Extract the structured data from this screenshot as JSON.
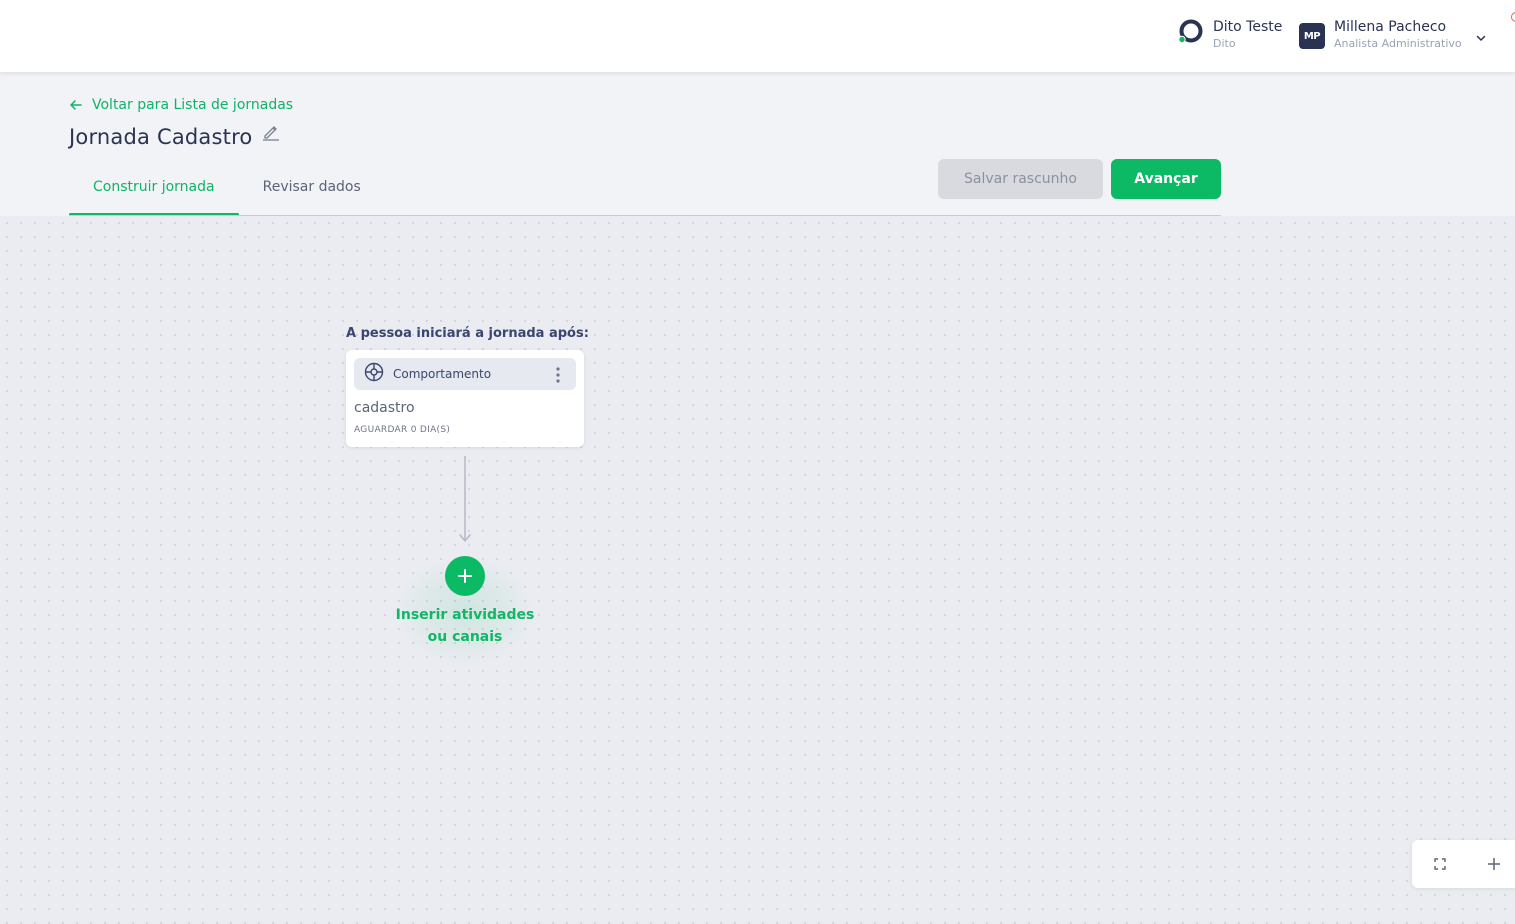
{
  "topbar": {
    "brand": {
      "name": "Dito Teste",
      "subtitle": "Dito"
    },
    "user": {
      "initials": "MP",
      "name": "Millena Pacheco",
      "role": "Analista Administrativo"
    }
  },
  "header": {
    "back_link": "Voltar para Lista de jornadas",
    "title": "Jornada Cadastro",
    "tabs": [
      {
        "label": "Construir jornada",
        "active": true
      },
      {
        "label": "Revisar dados",
        "active": false
      }
    ],
    "buttons": {
      "save_draft": "Salvar rascunho",
      "next": "Avançar"
    }
  },
  "canvas": {
    "start_label": "A pessoa iniciará a jornada após:",
    "trigger_node": {
      "type_label": "Comportamento",
      "type_icon": "behavior-icon",
      "event_name": "cadastro",
      "wait_text": "AGUARDAR 0 DIA(S)"
    },
    "add_action": {
      "label_line1": "Inserir atividades",
      "label_line2": "ou canais"
    },
    "zoom_controls": [
      "fullscreen-icon",
      "zoom-in-icon"
    ]
  },
  "colors": {
    "accent_green": "#0cb964",
    "navy": "#2a3352",
    "disabled_button": "#d8dae0"
  }
}
